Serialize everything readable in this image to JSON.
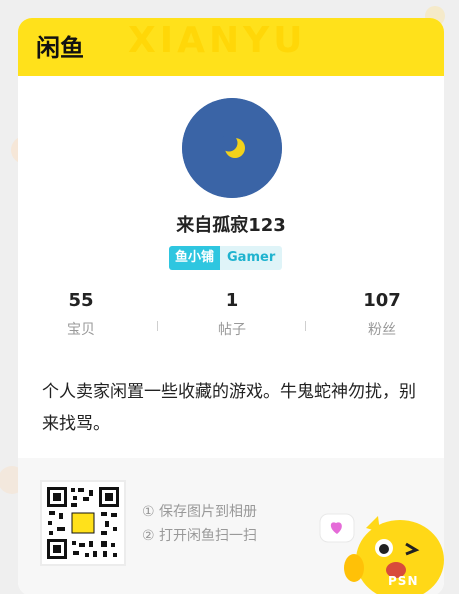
{
  "header": {
    "logo_text": "闲鱼",
    "watermark": "XIANYU"
  },
  "profile": {
    "username": "来自孤寂123",
    "badge_shop": "鱼小铺",
    "badge_tag": "Gamer"
  },
  "stats": [
    {
      "value": "55",
      "label": "宝贝"
    },
    {
      "value": "1",
      "label": "帖子"
    },
    {
      "value": "107",
      "label": "粉丝"
    }
  ],
  "bio": "个人卖家闲置一些收藏的游戏。牛鬼蛇神勿扰，别来找骂。",
  "footer": {
    "step1": "① 保存图片到相册",
    "step2": "② 打开闲鱼扫一扫",
    "qr_center_text": "闲鱼"
  },
  "watermark_site": "PSN",
  "colors": {
    "brand_yellow": "#ffe11b",
    "avatar_blue": "#3a64a6",
    "badge_blue": "#2ec6e0"
  }
}
